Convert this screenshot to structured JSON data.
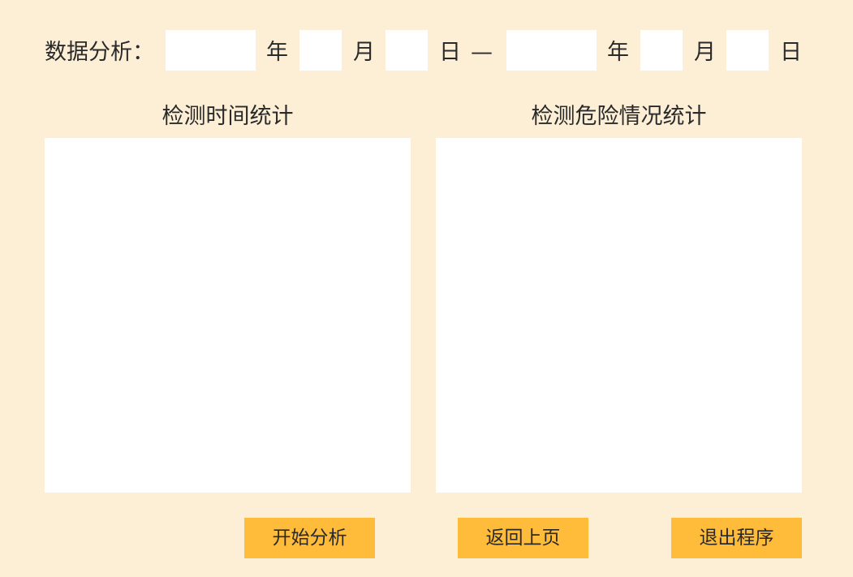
{
  "date_range": {
    "label": "数据分析：",
    "separator": "—",
    "start": {
      "year": "",
      "year_unit": "年",
      "month": "",
      "month_unit": "月",
      "day": "",
      "day_unit": "日"
    },
    "end": {
      "year": "",
      "year_unit": "年",
      "month": "",
      "month_unit": "月",
      "day": "",
      "day_unit": "日"
    }
  },
  "panels": {
    "time_stats": {
      "title": "检测时间统计"
    },
    "danger_stats": {
      "title": "检测危险情况统计"
    }
  },
  "buttons": {
    "start_analysis": "开始分析",
    "back": "返回上页",
    "exit": "退出程序"
  },
  "colors": {
    "background": "#fdefd6",
    "field": "#ffffff",
    "button": "#ffbb3a",
    "text": "#2a2a2a"
  }
}
